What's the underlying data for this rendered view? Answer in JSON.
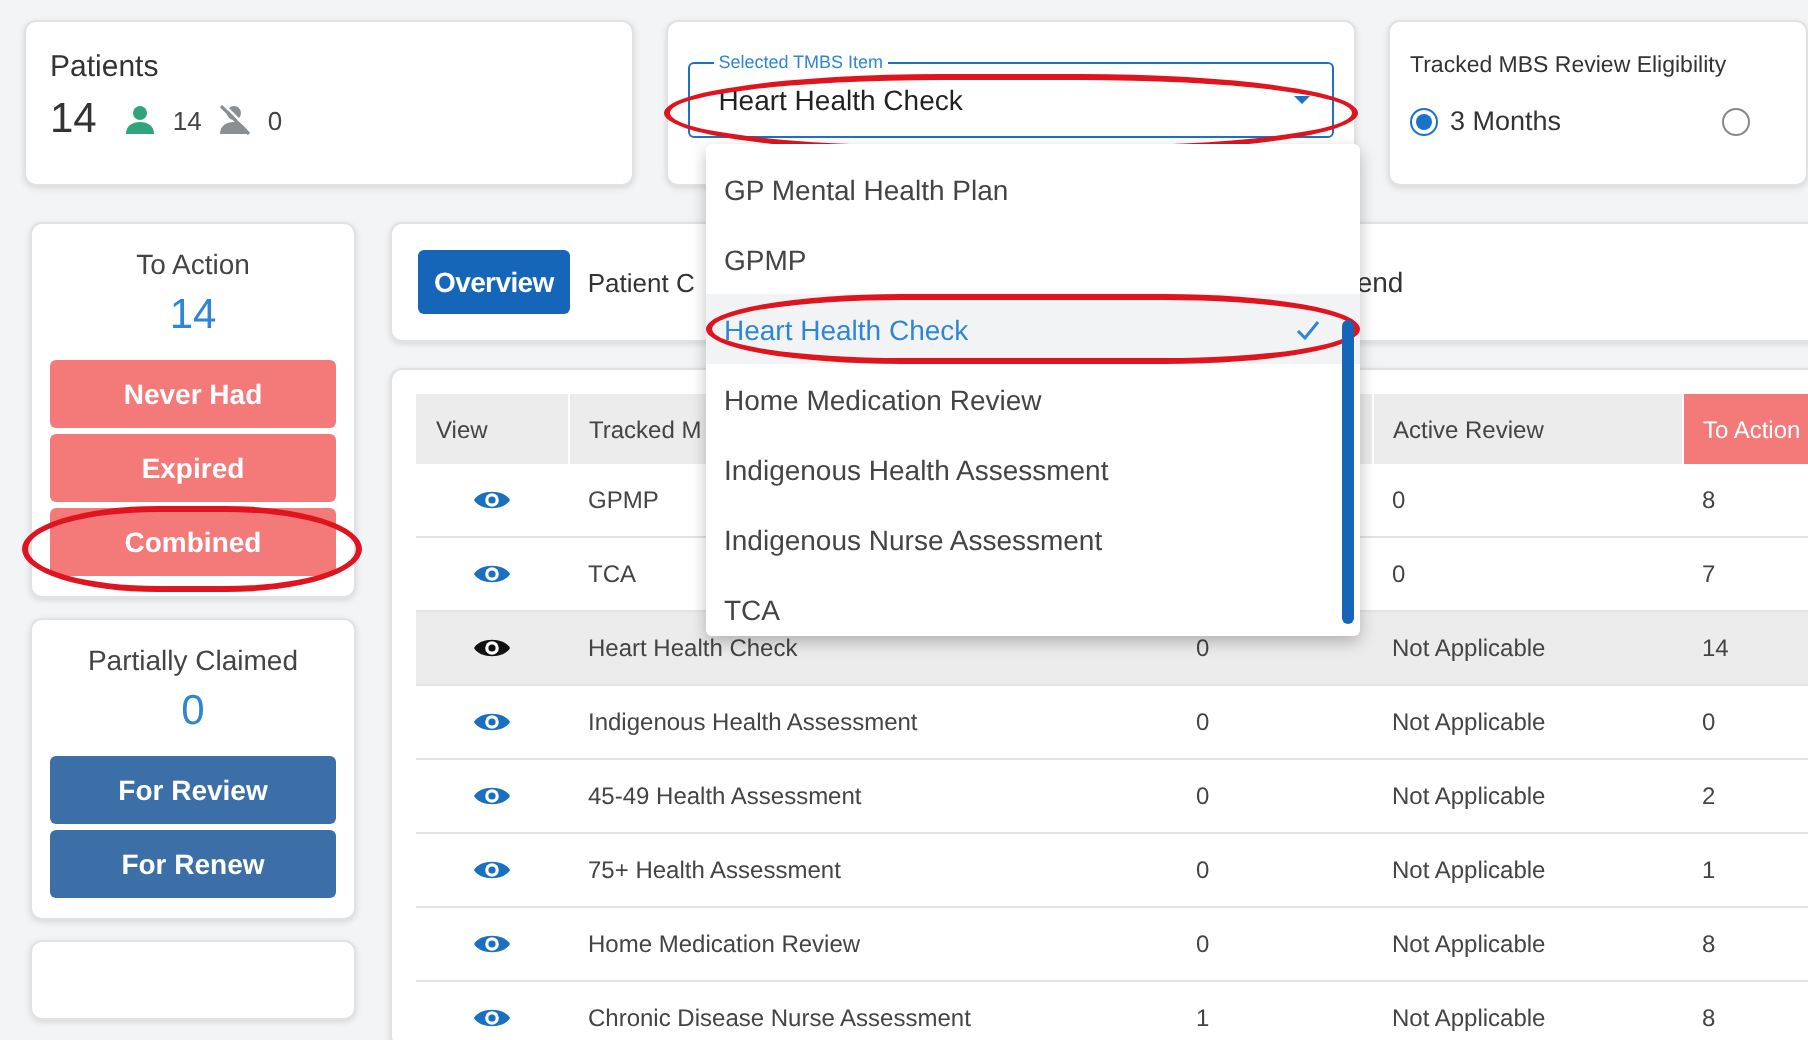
{
  "patients_card": {
    "title": "Patients",
    "total": "14",
    "active_count": "14",
    "inactive_count": "0"
  },
  "tmbs_select": {
    "label": "Selected TMBS Item",
    "value": "Heart Health Check",
    "circled": true,
    "expanded": true,
    "options": [
      {
        "label": "GP Mental Health Plan",
        "selected": false,
        "circled": false
      },
      {
        "label": "GPMP",
        "selected": false,
        "circled": false
      },
      {
        "label": "Heart Health Check",
        "selected": true,
        "circled": true
      },
      {
        "label": "Home Medication Review",
        "selected": false,
        "circled": false
      },
      {
        "label": "Indigenous Health Assessment",
        "selected": false,
        "circled": false
      },
      {
        "label": "Indigenous Nurse Assessment",
        "selected": false,
        "circled": false
      },
      {
        "label": "TCA",
        "selected": false,
        "circled": false
      }
    ]
  },
  "eligibility": {
    "title": "Tracked MBS Review Eligibility",
    "options": [
      {
        "label": "3 Months",
        "selected": true
      },
      {
        "selected": false
      }
    ]
  },
  "to_action": {
    "title": "To Action",
    "count": "14",
    "buttons": [
      {
        "label": "Never Had",
        "circled": false
      },
      {
        "label": "Expired",
        "circled": false
      },
      {
        "label": "Combined",
        "circled": true
      }
    ]
  },
  "partially_claimed": {
    "title": "Partially Claimed",
    "count": "0",
    "buttons": [
      {
        "label": "For Review",
        "circled": false
      },
      {
        "label": "For Renew",
        "circled": false
      }
    ]
  },
  "tabs": [
    {
      "label": "Overview",
      "selected": true
    },
    {
      "label": "Patient C",
      "selected": false
    },
    {
      "label": "end",
      "selected": false
    }
  ],
  "table": {
    "columns": [
      {
        "label": "View",
        "highlighted": false
      },
      {
        "label": "Tracked M",
        "highlighted": false
      },
      {
        "highlighted": false
      },
      {
        "label": "Active Review",
        "highlighted": false
      },
      {
        "label": "To Action",
        "highlighted": true
      }
    ],
    "rows": [
      {
        "item": "GPMP",
        "column_3": null,
        "active_review": "0",
        "to_action": "8",
        "selected": false
      },
      {
        "item": "TCA",
        "column_3": null,
        "active_review": "0",
        "to_action": "7",
        "selected": false
      },
      {
        "item": "Heart Health Check",
        "column_3": "0",
        "active_review": "Not Applicable",
        "to_action": "14",
        "selected": true
      },
      {
        "item": "Indigenous Health Assessment",
        "column_3": "0",
        "active_review": "Not Applicable",
        "to_action": "0",
        "selected": false
      },
      {
        "item": "45-49 Health Assessment",
        "column_3": "0",
        "active_review": "Not Applicable",
        "to_action": "2",
        "selected": false
      },
      {
        "item": "75+ Health Assessment",
        "column_3": "0",
        "active_review": "Not Applicable",
        "to_action": "1",
        "selected": false
      },
      {
        "item": "Home Medication Review",
        "column_3": "0",
        "active_review": "Not Applicable",
        "to_action": "8",
        "selected": false
      },
      {
        "item": "Chronic Disease Nurse Assessment",
        "column_3": "1",
        "active_review": "Not Applicable",
        "to_action": "8",
        "selected": false
      }
    ]
  }
}
